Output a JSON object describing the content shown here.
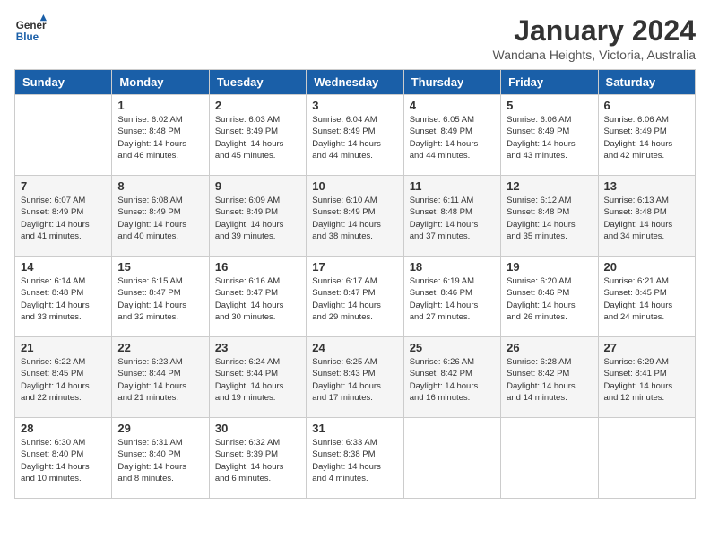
{
  "header": {
    "logo_general": "General",
    "logo_blue": "Blue",
    "month": "January 2024",
    "location": "Wandana Heights, Victoria, Australia"
  },
  "days_of_week": [
    "Sunday",
    "Monday",
    "Tuesday",
    "Wednesday",
    "Thursday",
    "Friday",
    "Saturday"
  ],
  "weeks": [
    [
      {
        "day": "",
        "info": ""
      },
      {
        "day": "1",
        "info": "Sunrise: 6:02 AM\nSunset: 8:48 PM\nDaylight: 14 hours\nand 46 minutes."
      },
      {
        "day": "2",
        "info": "Sunrise: 6:03 AM\nSunset: 8:49 PM\nDaylight: 14 hours\nand 45 minutes."
      },
      {
        "day": "3",
        "info": "Sunrise: 6:04 AM\nSunset: 8:49 PM\nDaylight: 14 hours\nand 44 minutes."
      },
      {
        "day": "4",
        "info": "Sunrise: 6:05 AM\nSunset: 8:49 PM\nDaylight: 14 hours\nand 44 minutes."
      },
      {
        "day": "5",
        "info": "Sunrise: 6:06 AM\nSunset: 8:49 PM\nDaylight: 14 hours\nand 43 minutes."
      },
      {
        "day": "6",
        "info": "Sunrise: 6:06 AM\nSunset: 8:49 PM\nDaylight: 14 hours\nand 42 minutes."
      }
    ],
    [
      {
        "day": "7",
        "info": "Sunrise: 6:07 AM\nSunset: 8:49 PM\nDaylight: 14 hours\nand 41 minutes."
      },
      {
        "day": "8",
        "info": "Sunrise: 6:08 AM\nSunset: 8:49 PM\nDaylight: 14 hours\nand 40 minutes."
      },
      {
        "day": "9",
        "info": "Sunrise: 6:09 AM\nSunset: 8:49 PM\nDaylight: 14 hours\nand 39 minutes."
      },
      {
        "day": "10",
        "info": "Sunrise: 6:10 AM\nSunset: 8:49 PM\nDaylight: 14 hours\nand 38 minutes."
      },
      {
        "day": "11",
        "info": "Sunrise: 6:11 AM\nSunset: 8:48 PM\nDaylight: 14 hours\nand 37 minutes."
      },
      {
        "day": "12",
        "info": "Sunrise: 6:12 AM\nSunset: 8:48 PM\nDaylight: 14 hours\nand 35 minutes."
      },
      {
        "day": "13",
        "info": "Sunrise: 6:13 AM\nSunset: 8:48 PM\nDaylight: 14 hours\nand 34 minutes."
      }
    ],
    [
      {
        "day": "14",
        "info": "Sunrise: 6:14 AM\nSunset: 8:48 PM\nDaylight: 14 hours\nand 33 minutes."
      },
      {
        "day": "15",
        "info": "Sunrise: 6:15 AM\nSunset: 8:47 PM\nDaylight: 14 hours\nand 32 minutes."
      },
      {
        "day": "16",
        "info": "Sunrise: 6:16 AM\nSunset: 8:47 PM\nDaylight: 14 hours\nand 30 minutes."
      },
      {
        "day": "17",
        "info": "Sunrise: 6:17 AM\nSunset: 8:47 PM\nDaylight: 14 hours\nand 29 minutes."
      },
      {
        "day": "18",
        "info": "Sunrise: 6:19 AM\nSunset: 8:46 PM\nDaylight: 14 hours\nand 27 minutes."
      },
      {
        "day": "19",
        "info": "Sunrise: 6:20 AM\nSunset: 8:46 PM\nDaylight: 14 hours\nand 26 minutes."
      },
      {
        "day": "20",
        "info": "Sunrise: 6:21 AM\nSunset: 8:45 PM\nDaylight: 14 hours\nand 24 minutes."
      }
    ],
    [
      {
        "day": "21",
        "info": "Sunrise: 6:22 AM\nSunset: 8:45 PM\nDaylight: 14 hours\nand 22 minutes."
      },
      {
        "day": "22",
        "info": "Sunrise: 6:23 AM\nSunset: 8:44 PM\nDaylight: 14 hours\nand 21 minutes."
      },
      {
        "day": "23",
        "info": "Sunrise: 6:24 AM\nSunset: 8:44 PM\nDaylight: 14 hours\nand 19 minutes."
      },
      {
        "day": "24",
        "info": "Sunrise: 6:25 AM\nSunset: 8:43 PM\nDaylight: 14 hours\nand 17 minutes."
      },
      {
        "day": "25",
        "info": "Sunrise: 6:26 AM\nSunset: 8:42 PM\nDaylight: 14 hours\nand 16 minutes."
      },
      {
        "day": "26",
        "info": "Sunrise: 6:28 AM\nSunset: 8:42 PM\nDaylight: 14 hours\nand 14 minutes."
      },
      {
        "day": "27",
        "info": "Sunrise: 6:29 AM\nSunset: 8:41 PM\nDaylight: 14 hours\nand 12 minutes."
      }
    ],
    [
      {
        "day": "28",
        "info": "Sunrise: 6:30 AM\nSunset: 8:40 PM\nDaylight: 14 hours\nand 10 minutes."
      },
      {
        "day": "29",
        "info": "Sunrise: 6:31 AM\nSunset: 8:40 PM\nDaylight: 14 hours\nand 8 minutes."
      },
      {
        "day": "30",
        "info": "Sunrise: 6:32 AM\nSunset: 8:39 PM\nDaylight: 14 hours\nand 6 minutes."
      },
      {
        "day": "31",
        "info": "Sunrise: 6:33 AM\nSunset: 8:38 PM\nDaylight: 14 hours\nand 4 minutes."
      },
      {
        "day": "",
        "info": ""
      },
      {
        "day": "",
        "info": ""
      },
      {
        "day": "",
        "info": ""
      }
    ]
  ]
}
